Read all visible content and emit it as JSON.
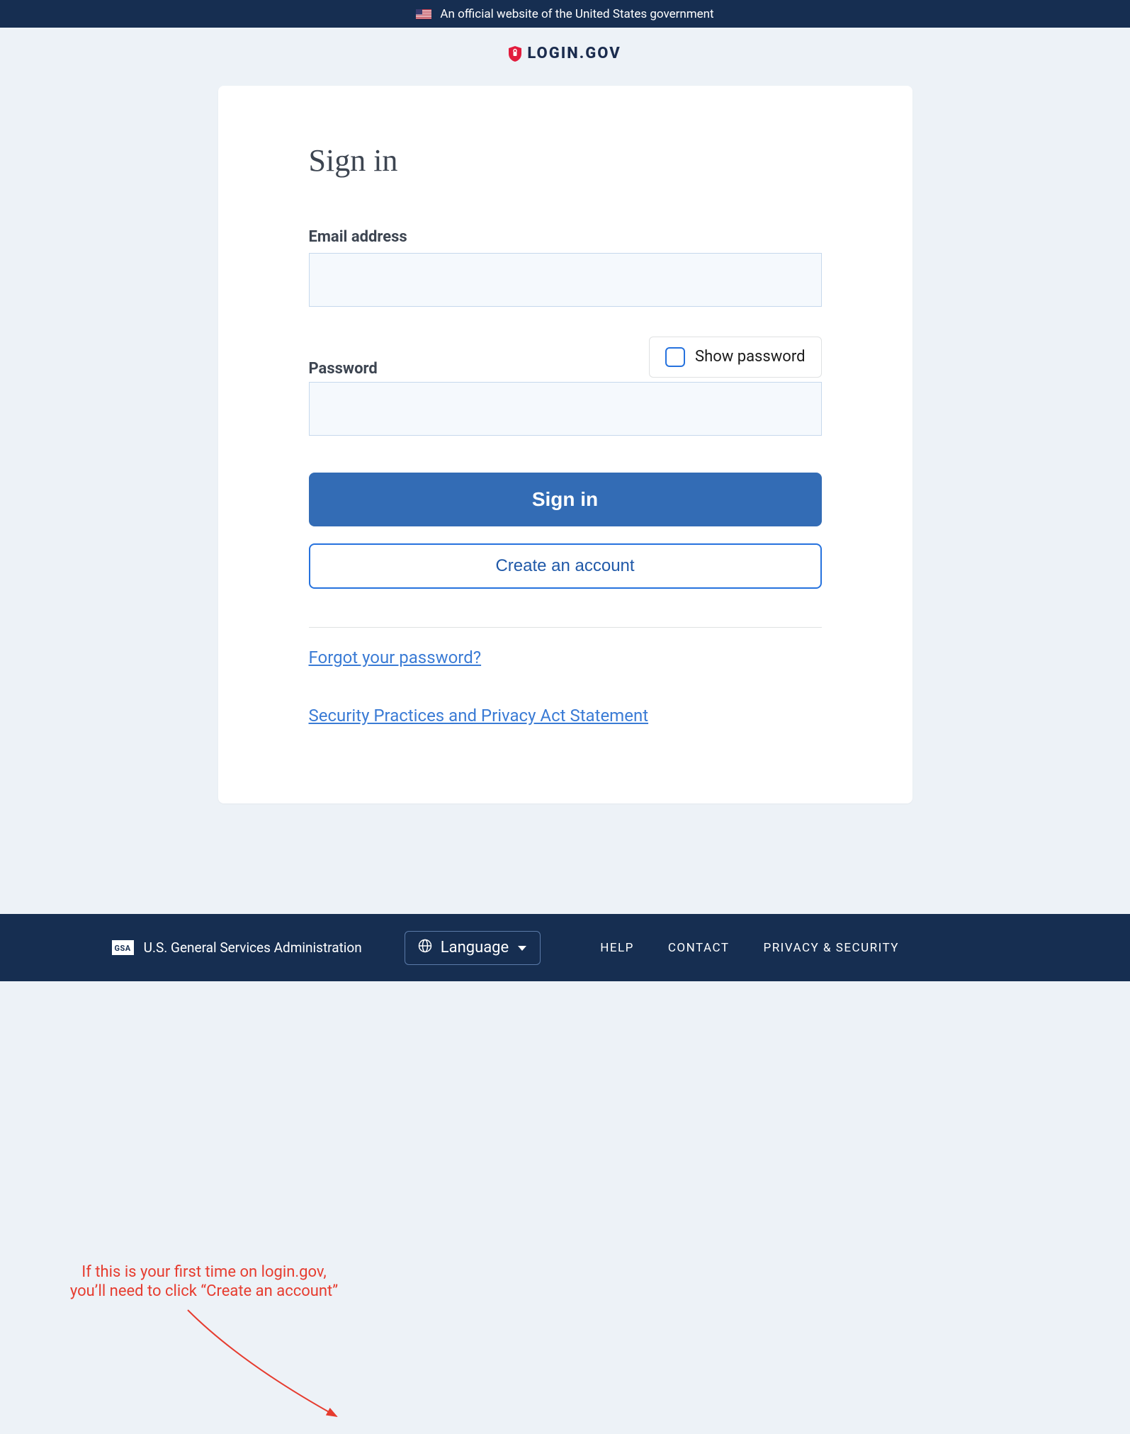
{
  "colors": {
    "brand_navy": "#162e51",
    "accent_blue": "#2672de",
    "primary_button": "#336cb5",
    "annotation_red": "#e63c2f"
  },
  "banner": {
    "text": "An official website of the United States government"
  },
  "logo": {
    "text": "LOGIN.GOV"
  },
  "form": {
    "title": "Sign in",
    "email_label": "Email address",
    "password_label": "Password",
    "show_password_label": "Show password",
    "signin_button": "Sign in",
    "create_account_button": "Create an account",
    "forgot_password_link": "Forgot your password?",
    "security_link": "Security Practices and Privacy Act Statement"
  },
  "annotation": {
    "line1": "If this is your first time on login.gov,",
    "line2": "you’ll need to click “Create an account”"
  },
  "footer": {
    "gsa_badge": "GSA",
    "org_text": "U.S. General Services Administration",
    "language_button": "Language",
    "links": {
      "help": "HELP",
      "contact": "CONTACT",
      "privacy": "PRIVACY & SECURITY"
    }
  }
}
